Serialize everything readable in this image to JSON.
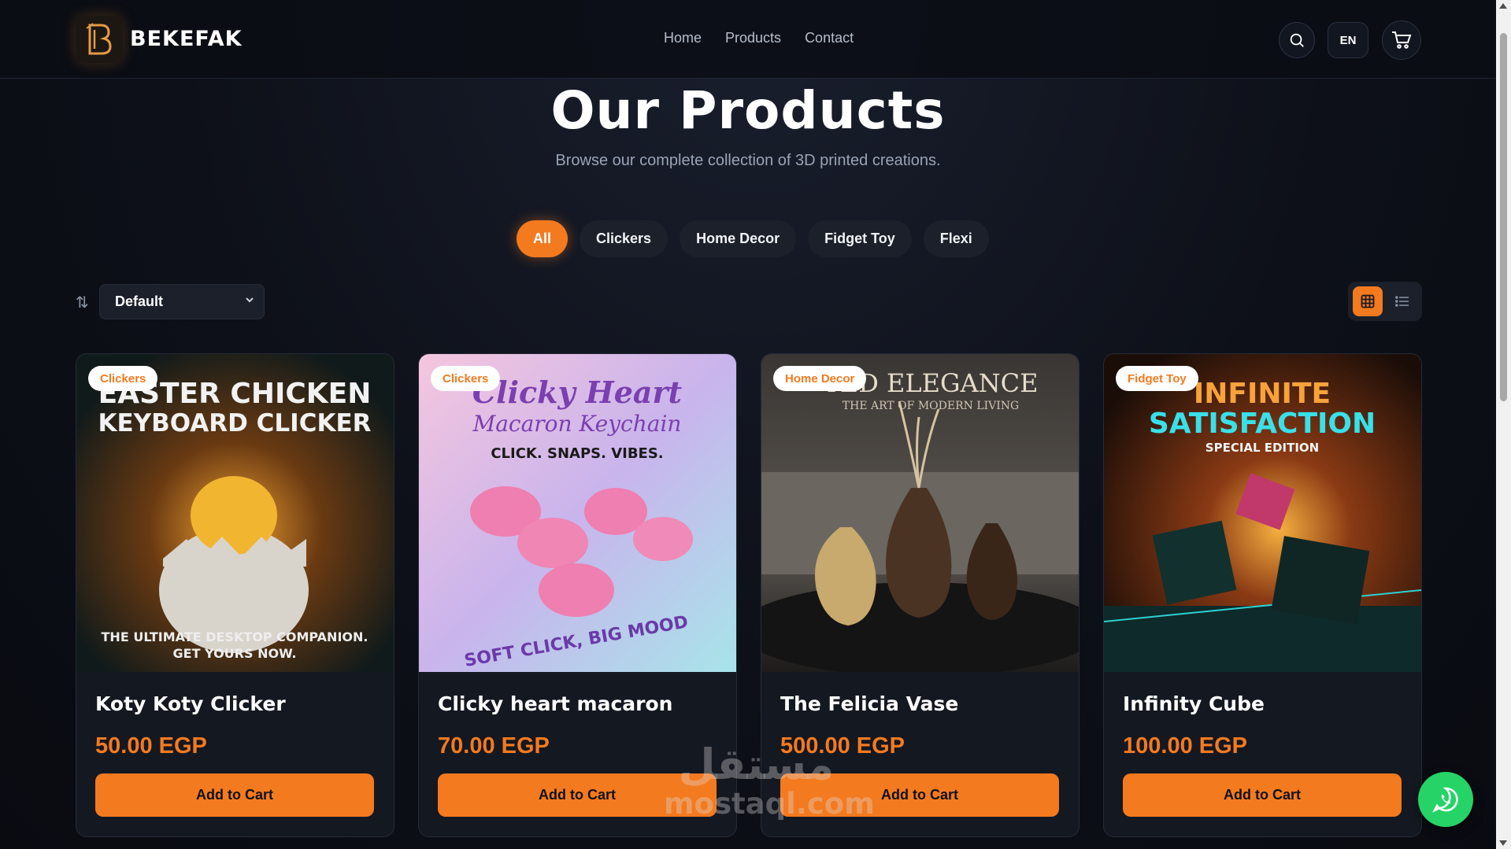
{
  "header": {
    "brand": "BEKEFAK",
    "nav": [
      "Home",
      "Products",
      "Contact"
    ],
    "lang": "EN",
    "icons": [
      "search-icon",
      "cart-icon"
    ]
  },
  "hero": {
    "title": "Our Products",
    "subtitle": "Browse our complete collection of 3D printed creations."
  },
  "filters": {
    "items": [
      "All",
      "Clickers",
      "Home Decor",
      "Fidget Toy",
      "Flexi"
    ],
    "active": "All"
  },
  "sort": {
    "selected": "Default"
  },
  "view": {
    "active": "grid"
  },
  "products": [
    {
      "name": "Koty Koty Clicker",
      "price": "50.00 EGP",
      "category": "Clickers",
      "button": "Add to Cart",
      "image_text": [
        "EASTER CHICKEN",
        "KEYBOARD CLICKER",
        "THE ULTIMATE DESKTOP COMPANION.",
        "GET YOURS NOW."
      ]
    },
    {
      "name": "Clicky heart macaron",
      "price": "70.00 EGP",
      "category": "Clickers",
      "button": "Add to Cart",
      "image_text": [
        "Clicky Heart",
        "Macaron Keychain",
        "CLICK. SNAPS. VIBES.",
        "SOFT CLICK, BIG MOOD"
      ]
    },
    {
      "name": "The Felicia Vase",
      "price": "500.00 EGP",
      "category": "Home Decor",
      "button": "Add to Cart",
      "image_text": [
        "TED ELEGANCE",
        "THE ART OF MODERN LIVING"
      ]
    },
    {
      "name": "Infinity Cube",
      "price": "100.00 EGP",
      "category": "Fidget Toy",
      "button": "Add to Cart",
      "image_text": [
        "INFINITE",
        "SATISFACTION",
        "SPECIAL EDITION"
      ]
    }
  ],
  "watermark": {
    "arabic": "مستقل",
    "latin": "mostaql.com"
  },
  "colors": {
    "accent": "#f47a1f",
    "background": "#0d1018",
    "card": "#141821",
    "whatsapp": "#25d366"
  }
}
